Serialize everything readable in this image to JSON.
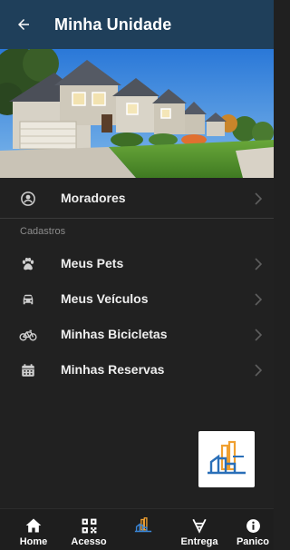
{
  "header": {
    "title": "Minha Unidade",
    "back_icon": "arrow-left-icon"
  },
  "menu": {
    "residents": {
      "label": "Moradores",
      "icon": "user-circle-icon"
    },
    "section_title": "Cadastros",
    "items": [
      {
        "label": "Meus Pets",
        "icon": "paw-icon"
      },
      {
        "label": "Meus Veículos",
        "icon": "car-icon"
      },
      {
        "label": "Minhas Bicicletas",
        "icon": "bicycle-icon"
      },
      {
        "label": "Minhas Reservas",
        "icon": "calendar-icon"
      }
    ]
  },
  "bottom_nav": [
    {
      "label": "Home",
      "icon": "home-icon"
    },
    {
      "label": "Acesso",
      "icon": "qr-code-icon"
    },
    {
      "label": "",
      "icon": "building-logo-icon"
    },
    {
      "label": "Entrega",
      "icon": "delivery-icon"
    },
    {
      "label": "Panico",
      "icon": "alert-info-icon"
    }
  ],
  "colors": {
    "header_bg": "#1f3f5a",
    "background": "#212121",
    "text": "#eeeeee",
    "section_label": "#8c8c8c",
    "logo_blue": "#2a6fb8",
    "logo_orange": "#f0a030"
  }
}
